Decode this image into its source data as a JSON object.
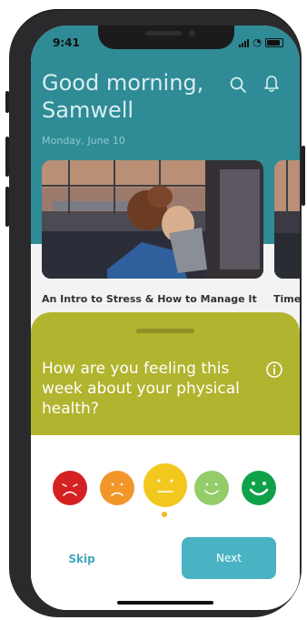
{
  "status_bar": {
    "time": "9:41"
  },
  "header": {
    "greeting": "Good morning, Samwell",
    "date": "Monday, June 10"
  },
  "icons": {
    "search": "search-icon",
    "notifications": "bell-icon",
    "info": "info-icon"
  },
  "cards": [
    {
      "title": "An Intro to Stress & How to Manage It"
    },
    {
      "title": "Time"
    }
  ],
  "survey": {
    "question": "How are you feeling this week about your physical health?",
    "moods": [
      {
        "name": "very-sad",
        "color": "#d42121"
      },
      {
        "name": "sad",
        "color": "#f2962a"
      },
      {
        "name": "neutral",
        "color": "#f2c81f",
        "selected": true
      },
      {
        "name": "happy",
        "color": "#94cc6a"
      },
      {
        "name": "very-happy",
        "color": "#0fa14a"
      }
    ]
  },
  "actions": {
    "skip_label": "Skip",
    "next_label": "Next"
  },
  "colors": {
    "header_teal": "#2f8b96",
    "sheet_olive": "#b1b42e",
    "button_teal": "#49b3c3"
  }
}
